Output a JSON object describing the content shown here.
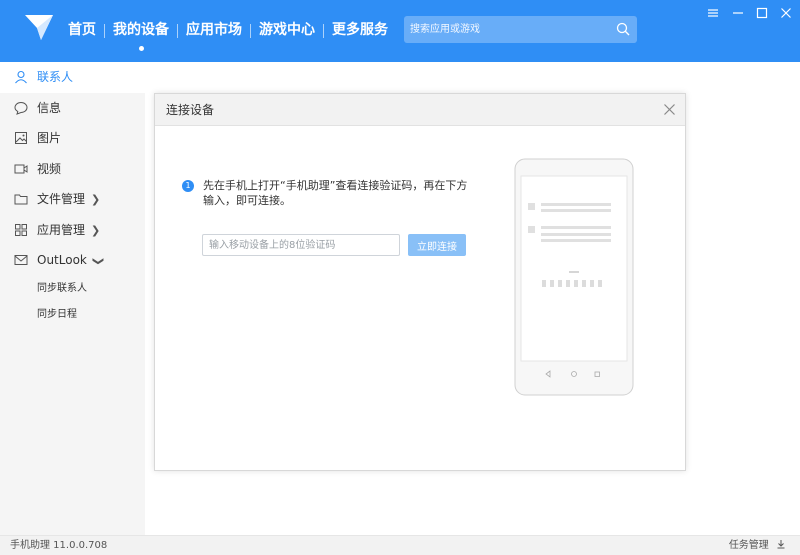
{
  "nav": {
    "items": [
      "首页",
      "我的设备",
      "应用市场",
      "游戏中心",
      "更多服务"
    ],
    "active_index": 1
  },
  "search": {
    "placeholder": "搜索应用或游戏"
  },
  "sidebar": {
    "items": [
      {
        "label": "联系人",
        "icon": "person-icon"
      },
      {
        "label": "信息",
        "icon": "chat-bubble-icon"
      },
      {
        "label": "图片",
        "icon": "image-icon"
      },
      {
        "label": "视频",
        "icon": "video-icon"
      },
      {
        "label": "文件管理",
        "icon": "folder-icon"
      },
      {
        "label": "应用管理",
        "icon": "apps-grid-icon"
      },
      {
        "label": "OutLook",
        "icon": "mail-icon"
      }
    ],
    "subitems": [
      "同步联系人",
      "同步日程"
    ],
    "active_index": 0
  },
  "dialog": {
    "title": "连接设备",
    "step_number": "1",
    "instruction": "先在手机上打开“手机助理”查看连接验证码，再在下方输入，即可连接。",
    "input_placeholder": "输入移动设备上的8位验证码",
    "connect_label": "立即连接"
  },
  "status": {
    "version": "手机助理 11.0.0.708",
    "tasks_label": "任务管理"
  },
  "colors": {
    "accent": "#2f8ef5",
    "button_disabled": "#89c0f7"
  }
}
